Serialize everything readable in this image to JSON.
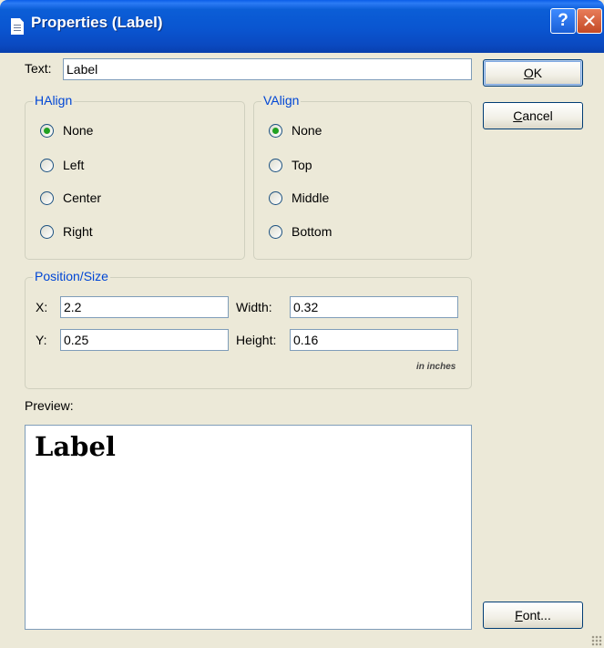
{
  "window": {
    "title": "Properties (Label)",
    "help_glyph": "?",
    "close_glyph": "✕"
  },
  "text_field": {
    "label": "Text:",
    "value": "Label"
  },
  "buttons": {
    "ok": {
      "mnemonic": "O",
      "rest": "K"
    },
    "cancel": {
      "mnemonic": "C",
      "rest": "ancel"
    },
    "font": {
      "mnemonic": "F",
      "rest": "ont..."
    }
  },
  "halign": {
    "title": "HAlign",
    "options": [
      {
        "label": "None",
        "checked": true
      },
      {
        "label": "Left",
        "checked": false
      },
      {
        "label": "Center",
        "checked": false
      },
      {
        "label": "Right",
        "checked": false
      }
    ]
  },
  "valign": {
    "title": "VAlign",
    "options": [
      {
        "label": "None",
        "checked": true
      },
      {
        "label": "Top",
        "checked": false
      },
      {
        "label": "Middle",
        "checked": false
      },
      {
        "label": "Bottom",
        "checked": false
      }
    ]
  },
  "position_size": {
    "title": "Position/Size",
    "x_label": "X:",
    "x_value": "2.2",
    "y_label": "Y:",
    "y_value": "0.25",
    "width_label": "Width:",
    "width_value": "0.32",
    "height_label": "Height:",
    "height_value": "0.16",
    "units_hint": "in inches"
  },
  "preview": {
    "label": "Preview:",
    "sample_text": "Label"
  },
  "colors": {
    "dialog_bg": "#ece9d8",
    "titlebar_blue": "#0a55d0",
    "group_title": "#0046d5",
    "radio_checked": "#21a121"
  }
}
